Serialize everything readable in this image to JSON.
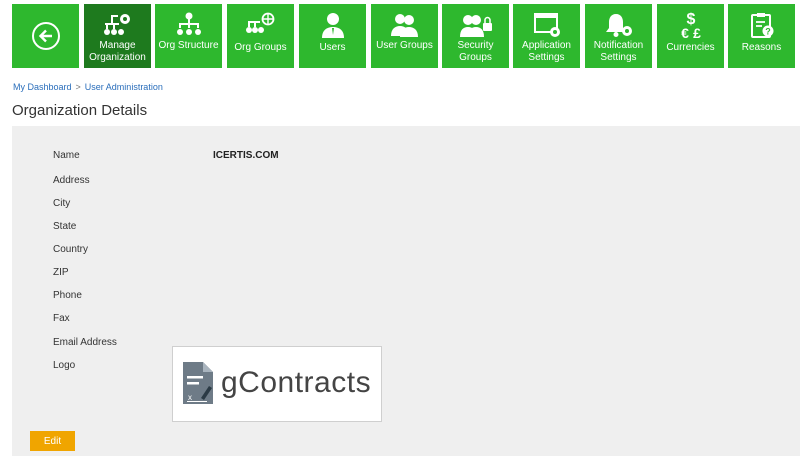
{
  "toolbar": {
    "back_icon": "back-arrow-icon",
    "tiles": [
      {
        "label": "Manage Organization",
        "icon": "org-settings-icon",
        "active": true
      },
      {
        "label": "Org Structure",
        "icon": "org-structure-icon",
        "active": false
      },
      {
        "label": "Org Groups",
        "icon": "org-groups-icon",
        "active": false
      },
      {
        "label": "Users",
        "icon": "user-icon",
        "active": false
      },
      {
        "label": "User Groups",
        "icon": "user-groups-icon",
        "active": false
      },
      {
        "label": "Security Groups",
        "icon": "security-groups-icon",
        "active": false
      },
      {
        "label": "Application Settings",
        "icon": "app-settings-icon",
        "active": false
      },
      {
        "label": "Notification Settings",
        "icon": "notification-settings-icon",
        "active": false
      },
      {
        "label": "Currencies",
        "icon": "currency-icon",
        "active": false
      },
      {
        "label": "Reasons",
        "icon": "reasons-icon",
        "active": false
      }
    ]
  },
  "breadcrumb": {
    "home": "My Dashboard",
    "separator": ">",
    "current": "User Administration"
  },
  "page_title": "Organization Details",
  "details": {
    "labels": [
      "Name",
      "Address",
      "City",
      "State",
      "Country",
      "ZIP",
      "Phone",
      "Fax",
      "Email Address",
      "Logo"
    ],
    "name_value": "ICERTIS.COM",
    "logo_text": "gContracts"
  },
  "edit_label": "Edit",
  "colors": {
    "tile": "#2eb82e",
    "tile_active": "#1e7a1e",
    "edit": "#f0a500",
    "panel": "#efefef"
  }
}
